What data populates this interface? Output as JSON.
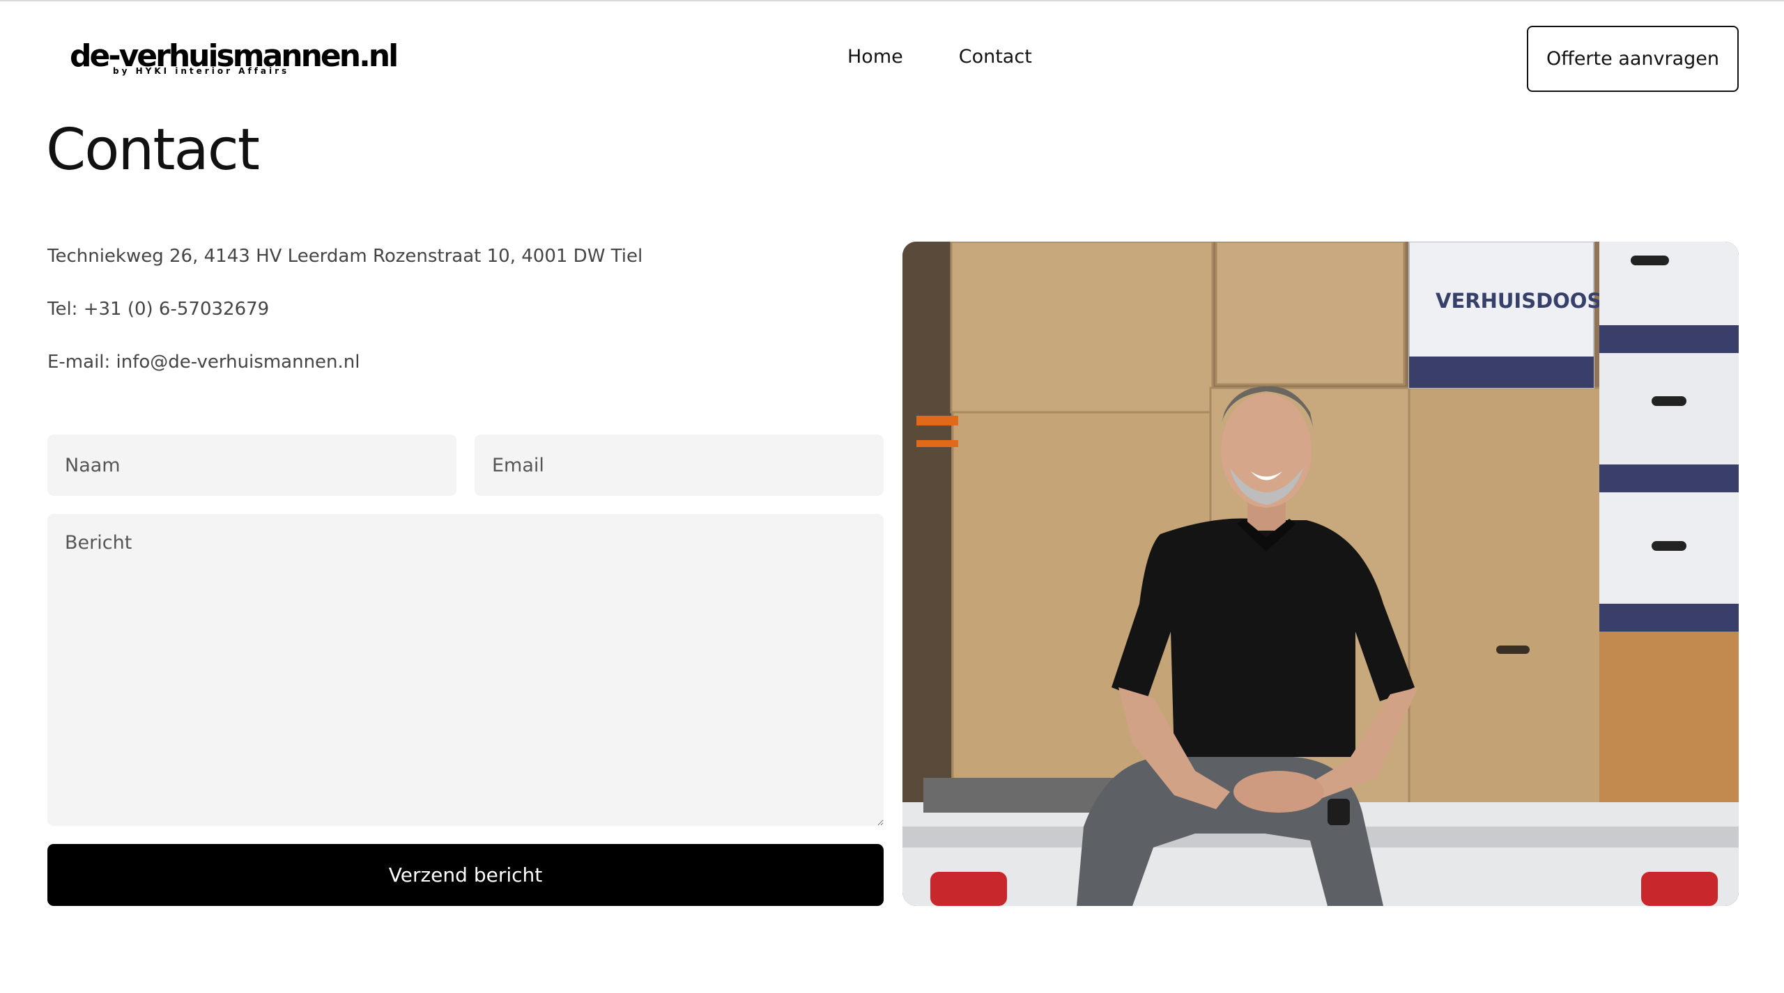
{
  "header": {
    "logo_text": "de-verhuismannen.nl",
    "logo_subtext": "by HYKI interior Affairs",
    "nav": [
      {
        "label": "Home"
      },
      {
        "label": "Contact"
      }
    ],
    "quote_button_label": "Offerte aanvragen"
  },
  "main": {
    "title": "Contact",
    "address": "Techniekweg 26, 4143 HV Leerdam Rozenstraat 10, 4001 DW Tiel",
    "tel": "Tel: +31 (0) 6-57032679",
    "email": "E-mail: info@de-verhuismannen.nl"
  },
  "form": {
    "name_placeholder": "Naam",
    "email_placeholder": "Email",
    "message_placeholder": "Bericht",
    "submit_label": "Verzend bericht"
  },
  "photo": {
    "box_label": "VERHUISDOOS",
    "icon": "photo-man-sitting-with-moving-boxes"
  },
  "colors": {
    "button_bg": "#000000",
    "field_bg": "#f4f4f4",
    "text": "#111111",
    "muted_text": "#444444"
  }
}
